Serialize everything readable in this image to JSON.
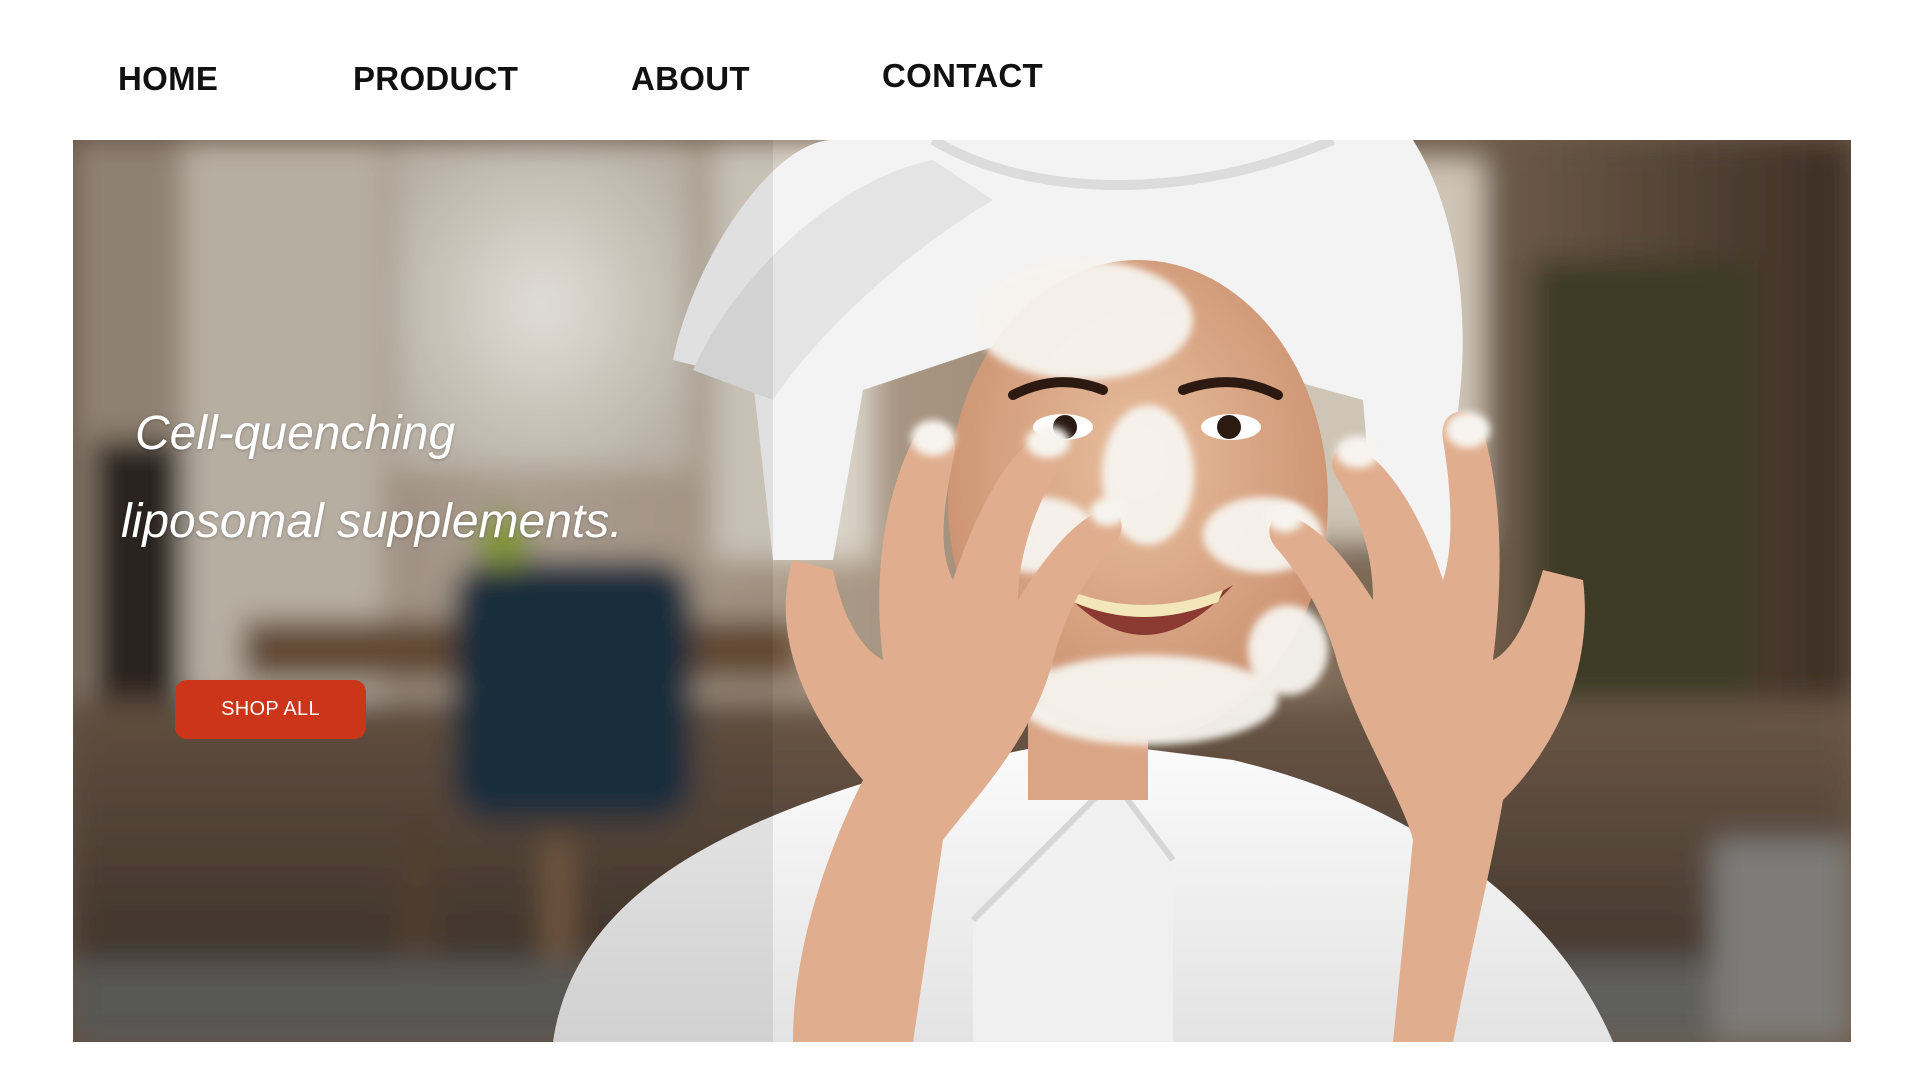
{
  "nav": {
    "items": [
      {
        "label": "HOME"
      },
      {
        "label": "PRODUCT"
      },
      {
        "label": "ABOUT"
      },
      {
        "label": "CONTACT"
      }
    ]
  },
  "hero": {
    "headline_line1": "Cell-quenching",
    "headline_line2": "liposomal supplements.",
    "cta_label": "SHOP ALL",
    "photo_subject": "smiling woman with towel on head applying face wash foam"
  },
  "colors": {
    "cta_background": "#cc3519",
    "cta_text": "#ffffff",
    "nav_text": "#111111",
    "headline_text": "#ffffff"
  }
}
